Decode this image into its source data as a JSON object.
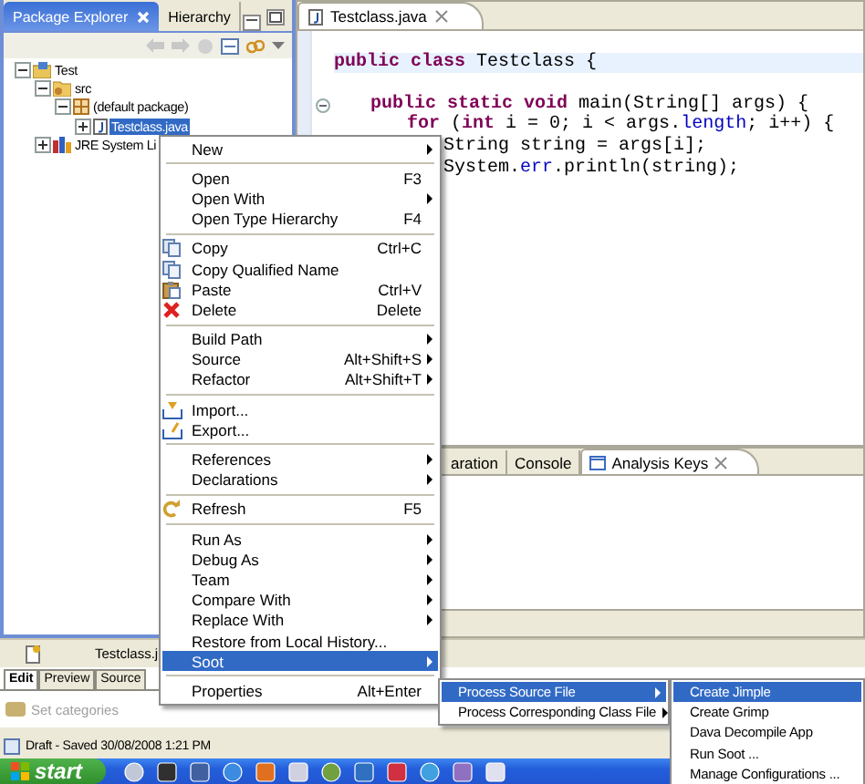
{
  "explorer": {
    "tabs": [
      {
        "label": "Package Explorer",
        "selected": true
      },
      {
        "label": "Hierarchy",
        "selected": false
      }
    ],
    "tree": [
      {
        "label": "Test",
        "kind": "project",
        "expanded": true,
        "selected": false,
        "children": [
          {
            "label": "src",
            "kind": "folder",
            "expanded": true,
            "selected": false,
            "children": [
              {
                "label": "(default package)",
                "kind": "package",
                "expanded": true,
                "selected": false,
                "children": [
                  {
                    "label": "Testclass.java",
                    "kind": "file",
                    "expanded": false,
                    "selected": true
                  }
                ]
              }
            ]
          },
          {
            "label": "JRE System Li",
            "kind": "library",
            "expanded": false,
            "selected": false
          }
        ]
      }
    ]
  },
  "editor": {
    "tab": "Testclass.java",
    "lines": [
      {
        "current": true,
        "blank_before": false,
        "foldable": false,
        "tokens": [
          {
            "kind": "keyword",
            "text": "public class"
          },
          {
            "kind": "plain",
            "text": " Testclass {"
          }
        ],
        "children": [
          {
            "current": false,
            "blank_before": true,
            "foldable": true,
            "tokens": [
              {
                "kind": "keyword",
                "text": "public static void"
              },
              {
                "kind": "plain",
                "text": " main(String[] args) {"
              }
            ],
            "children": [
              {
                "current": false,
                "blank_before": false,
                "foldable": false,
                "tokens": [
                  {
                    "kind": "keyword",
                    "text": "for"
                  },
                  {
                    "kind": "plain",
                    "text": " ("
                  },
                  {
                    "kind": "keyword",
                    "text": "int"
                  },
                  {
                    "kind": "plain",
                    "text": " i = 0; i < args."
                  },
                  {
                    "kind": "field",
                    "text": "length"
                  },
                  {
                    "kind": "plain",
                    "text": "; i++) {"
                  }
                ],
                "children": [
                  {
                    "current": false,
                    "blank_before": false,
                    "foldable": false,
                    "tokens": [
                      {
                        "kind": "plain",
                        "text": "String string = args[i];"
                      }
                    ]
                  },
                  {
                    "current": false,
                    "blank_before": false,
                    "foldable": false,
                    "tokens": [
                      {
                        "kind": "plain",
                        "text": "System."
                      },
                      {
                        "kind": "field",
                        "text": "err"
                      },
                      {
                        "kind": "plain",
                        "text": ".println(string);"
                      }
                    ]
                  }
                ]
              }
            ]
          }
        ]
      }
    ]
  },
  "bottom_panel": {
    "tabs": [
      {
        "label": "aration",
        "selected": false
      },
      {
        "label": "Console",
        "selected": false
      },
      {
        "label": "Analysis Keys",
        "selected": true
      }
    ]
  },
  "blog_editor": {
    "file_tab": "Testclass.j",
    "tabs": [
      {
        "label": "Edit",
        "selected": true
      },
      {
        "label": "Preview",
        "selected": false
      },
      {
        "label": "Source",
        "selected": false
      }
    ],
    "categories": {
      "placeholder": "Set categories"
    },
    "status": "Draft - Saved 30/08/2008 1:21 PM"
  },
  "taskbar": {
    "start": "start"
  },
  "context_menu": {
    "groups": [
      [
        {
          "label": "New",
          "submenu": true,
          "selected": false
        }
      ],
      [
        {
          "label": "Open",
          "shortcut": "F3",
          "submenu": false,
          "selected": false
        },
        {
          "label": "Open With",
          "submenu": true,
          "selected": false
        },
        {
          "label": "Open Type Hierarchy",
          "shortcut": "F4",
          "submenu": false,
          "selected": false
        }
      ],
      [
        {
          "label": "Copy",
          "shortcut": "Ctrl+C",
          "submenu": false,
          "selected": false
        },
        {
          "label": "Copy Qualified Name",
          "submenu": false,
          "selected": false
        },
        {
          "label": "Paste",
          "shortcut": "Ctrl+V",
          "submenu": false,
          "selected": false
        },
        {
          "label": "Delete",
          "shortcut": "Delete",
          "submenu": false,
          "selected": false
        }
      ],
      [
        {
          "label": "Build Path",
          "submenu": true,
          "selected": false
        },
        {
          "label": "Source",
          "shortcut": "Alt+Shift+S",
          "submenu": true,
          "selected": false
        },
        {
          "label": "Refactor",
          "shortcut": "Alt+Shift+T",
          "submenu": true,
          "selected": false
        }
      ],
      [
        {
          "label": "Import...",
          "submenu": false,
          "selected": false
        },
        {
          "label": "Export...",
          "submenu": false,
          "selected": false
        }
      ],
      [
        {
          "label": "References",
          "submenu": true,
          "selected": false
        },
        {
          "label": "Declarations",
          "submenu": true,
          "selected": false
        }
      ],
      [
        {
          "label": "Refresh",
          "shortcut": "F5",
          "submenu": false,
          "selected": false
        }
      ],
      [
        {
          "label": "Run As",
          "submenu": true,
          "selected": false
        },
        {
          "label": "Debug As",
          "submenu": true,
          "selected": false
        },
        {
          "label": "Team",
          "submenu": true,
          "selected": false
        },
        {
          "label": "Compare With",
          "submenu": true,
          "selected": false
        },
        {
          "label": "Replace With",
          "submenu": true,
          "selected": false
        },
        {
          "label": "Restore from Local History...",
          "submenu": false,
          "selected": false
        },
        {
          "label": "Soot",
          "submenu": true,
          "selected": true
        }
      ],
      [
        {
          "label": "Properties",
          "shortcut": "Alt+Enter",
          "submenu": false,
          "selected": false
        }
      ]
    ]
  },
  "soot_menu": {
    "groups": [
      [
        {
          "label": "Process Source File",
          "submenu": true,
          "selected": true
        },
        {
          "label": "Process Corresponding Class File",
          "submenu": true,
          "selected": false
        }
      ]
    ]
  },
  "process_menu": {
    "groups": [
      [
        {
          "label": "Create Jimple",
          "submenu": false,
          "selected": true
        },
        {
          "label": "Create Grimp",
          "submenu": false,
          "selected": false
        },
        {
          "label": "Dava Decompile App",
          "submenu": false,
          "selected": false
        },
        {
          "label": "Run Soot ...",
          "submenu": false,
          "selected": false
        },
        {
          "label": "Manage Configurations ...",
          "submenu": false,
          "selected": false
        }
      ]
    ]
  }
}
